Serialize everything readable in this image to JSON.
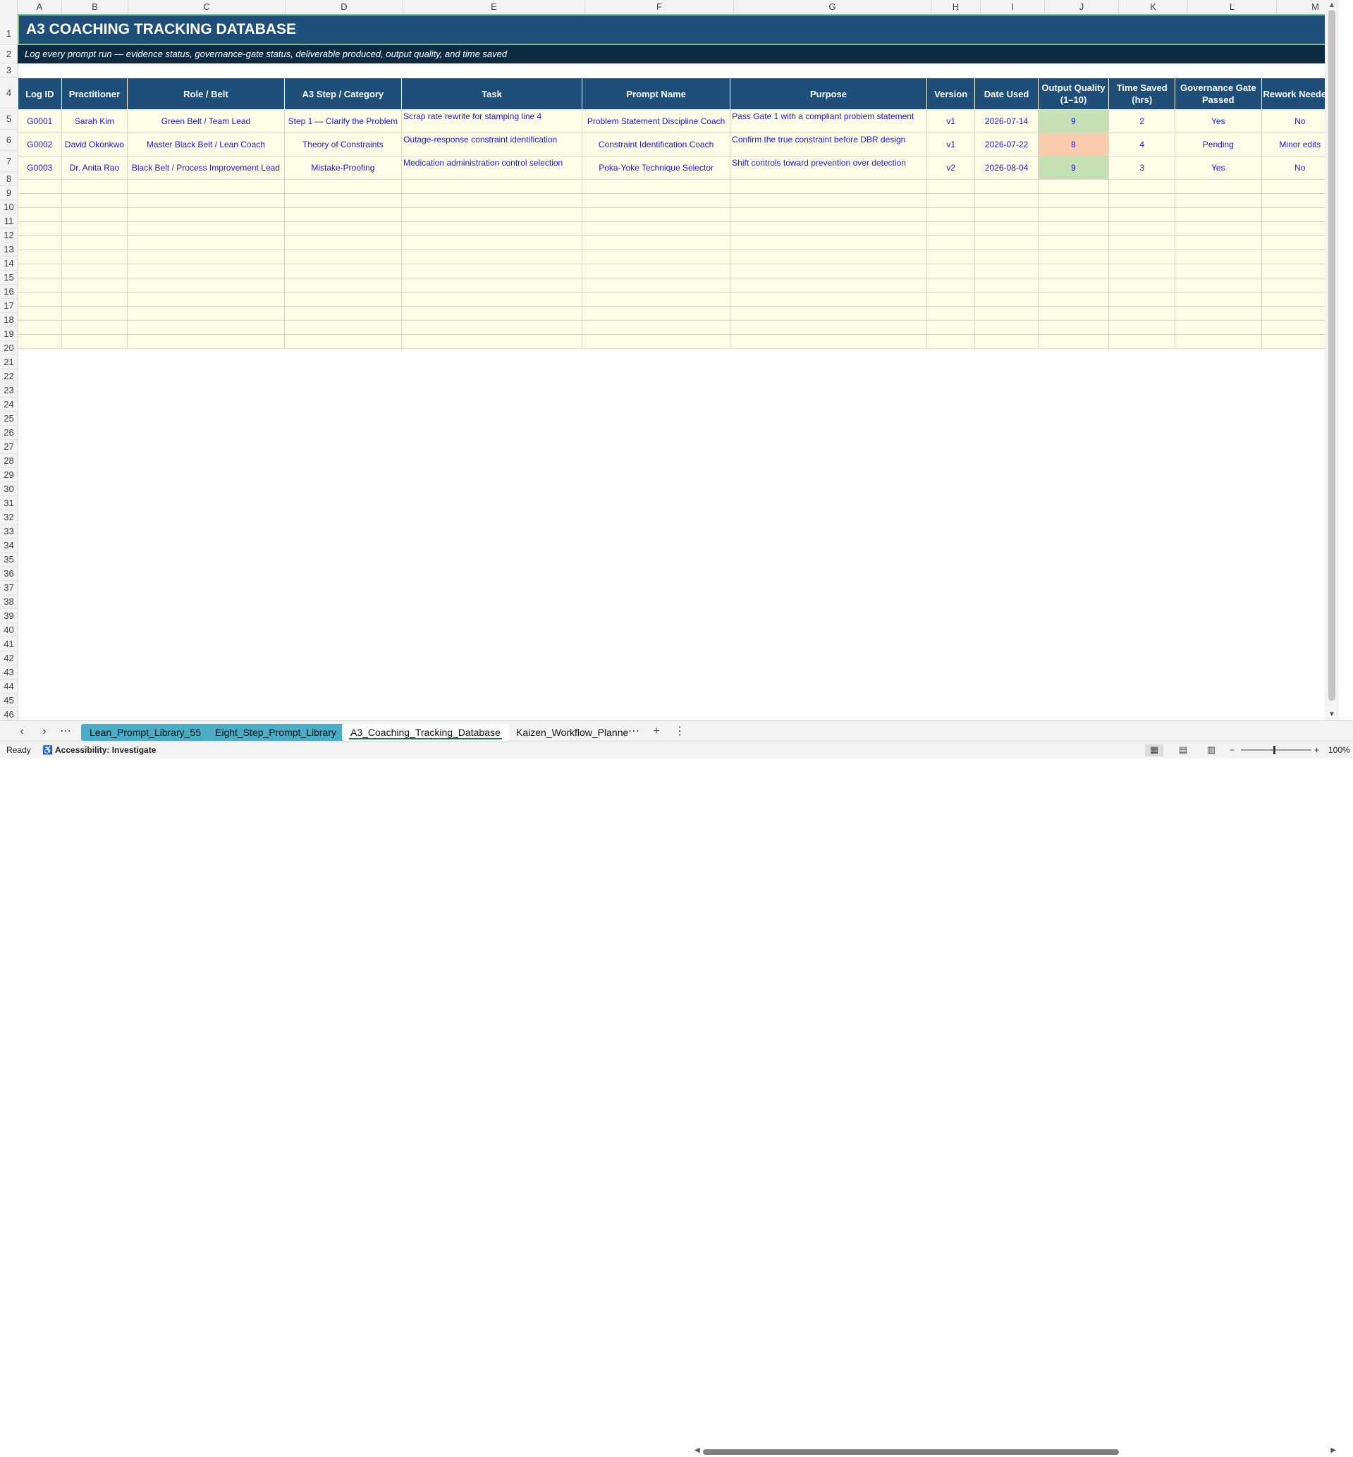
{
  "columns": [
    "A",
    "B",
    "C",
    "D",
    "E",
    "F",
    "G",
    "H",
    "I",
    "J",
    "K",
    "L",
    "M"
  ],
  "rows": [
    "1",
    "2",
    "3",
    "4",
    "5",
    "6",
    "7",
    "8",
    "9",
    "10",
    "11",
    "12",
    "13",
    "14",
    "15",
    "16",
    "17",
    "18",
    "19",
    "20",
    "21",
    "22",
    "23",
    "24",
    "25",
    "26",
    "27",
    "28",
    "29",
    "30",
    "31",
    "32",
    "33",
    "34",
    "35",
    "36",
    "37",
    "38",
    "39",
    "40",
    "41",
    "42",
    "43",
    "44",
    "45",
    "46"
  ],
  "sheet": {
    "title": "A3 COACHING TRACKING DATABASE",
    "subtitle": "Log every prompt run — evidence status, governance-gate status, deliverable produced, output quality, and time saved",
    "headers": [
      "Log ID",
      "Practitioner",
      "Role / Belt",
      "A3 Step / Category",
      "Task",
      "Prompt Name",
      "Purpose",
      "Version",
      "Date Used",
      "Output Quality (1–10)",
      "Time Saved (hrs)",
      "Governance Gate Passed",
      "Rework Needed"
    ],
    "records": [
      {
        "id": "G0001",
        "practitioner": "Sarah Kim",
        "role": "Green Belt / Team Lead",
        "step": "Step 1 — Clarify the Problem",
        "task": "Scrap rate rewrite for stamping line 4",
        "prompt": "Problem Statement Discipline Coach",
        "purpose": "Pass Gate 1 with a compliant problem statement",
        "version": "v1",
        "date": "2026-07-14",
        "quality": "9",
        "time_saved": "2",
        "gate": "Yes",
        "rework": "No"
      },
      {
        "id": "G0002",
        "practitioner": "David Okonkwo",
        "role": "Master Black Belt / Lean Coach",
        "step": "Theory of Constraints",
        "task": "Outage-response constraint identification",
        "prompt": "Constraint Identification Coach",
        "purpose": "Confirm the true constraint before DBR design",
        "version": "v1",
        "date": "2026-07-22",
        "quality": "8",
        "time_saved": "4",
        "gate": "Pending",
        "rework": "Minor edits"
      },
      {
        "id": "G0003",
        "practitioner": "Dr. Anita Rao",
        "role": "Black Belt / Process Improvement Lead",
        "step": "Mistake-Proofing",
        "task": "Medication administration control selection",
        "prompt": "Poka-Yoke Technique Selector",
        "purpose": "Shift controls toward prevention over detection",
        "version": "v2",
        "date": "2026-08-04",
        "quality": "9",
        "time_saved": "3",
        "gate": "Yes",
        "rework": "No"
      }
    ]
  },
  "tabs": [
    "Lean_Prompt_Library_55",
    "Eight_Step_Prompt_Library",
    "A3_Coaching_Tracking_Database",
    "Kaizen_Workflow_Planne"
  ],
  "status": {
    "ready": "Ready",
    "accessibility": "Accessibility: Investigate",
    "zoom": "100%"
  },
  "colors": {
    "header_bg": "#1f4e79",
    "title_border": "#7bbf8a",
    "cell_bg": "#fffde7",
    "quality_good": "#c6e0b4",
    "quality_warn": "#f8cbad",
    "tab_color": "#4bacc6"
  }
}
